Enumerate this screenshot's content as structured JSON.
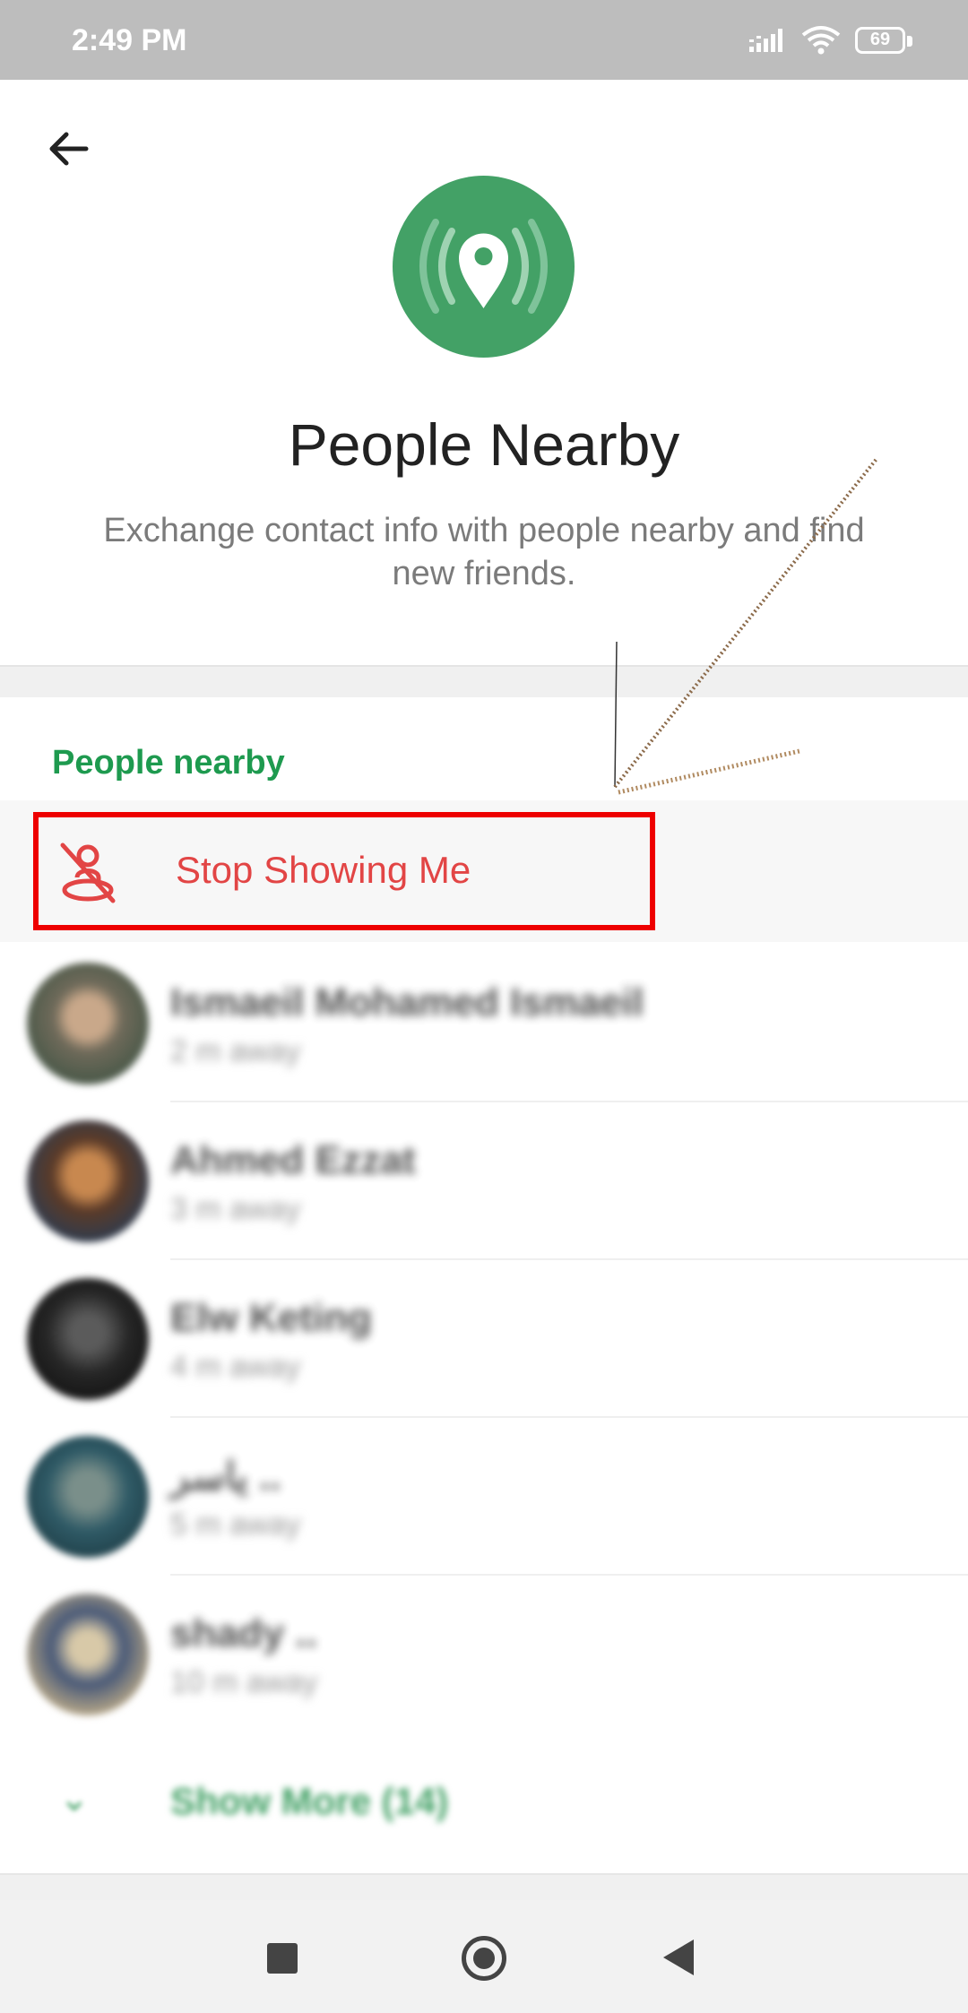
{
  "status_bar": {
    "time": "2:49 PM",
    "battery": "69"
  },
  "header": {
    "title": "People Nearby",
    "description": "Exchange contact info with people nearby and find new friends."
  },
  "section": {
    "title": "People nearby"
  },
  "stop_showing": {
    "label": "Stop Showing Me"
  },
  "people": [
    {
      "name": "Ismaeil Mohamed Ismaeil",
      "distance": "2 m away"
    },
    {
      "name": "Ahmed Ezzat",
      "distance": "3 m away"
    },
    {
      "name": "Elw Keting",
      "distance": "4 m away"
    },
    {
      "name": "ياسر ..",
      "distance": "5 m away"
    },
    {
      "name": "shady ..",
      "distance": "10 m away"
    }
  ],
  "show_more": {
    "label": "Show More (14)"
  },
  "colors": {
    "accent_green": "#43a166",
    "section_green": "#1e9a4f",
    "stop_red": "#e24545",
    "highlight_red": "#ee0000"
  }
}
